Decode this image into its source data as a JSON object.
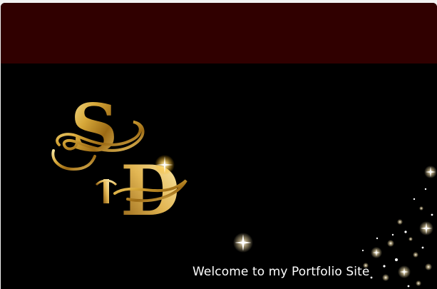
{
  "header": {
    "background_color": "#300000"
  },
  "hero": {
    "background_color": "#000000",
    "logo_icon": "sd-monogram-logo",
    "logo_text": "SD",
    "welcome_text": "Welcome to my Portfolio Site",
    "sparkle_icon": "sparkle-icon"
  },
  "colors": {
    "gold": "#d8a93a",
    "gold_light": "#f6e6a0",
    "text": "#ffffff"
  }
}
